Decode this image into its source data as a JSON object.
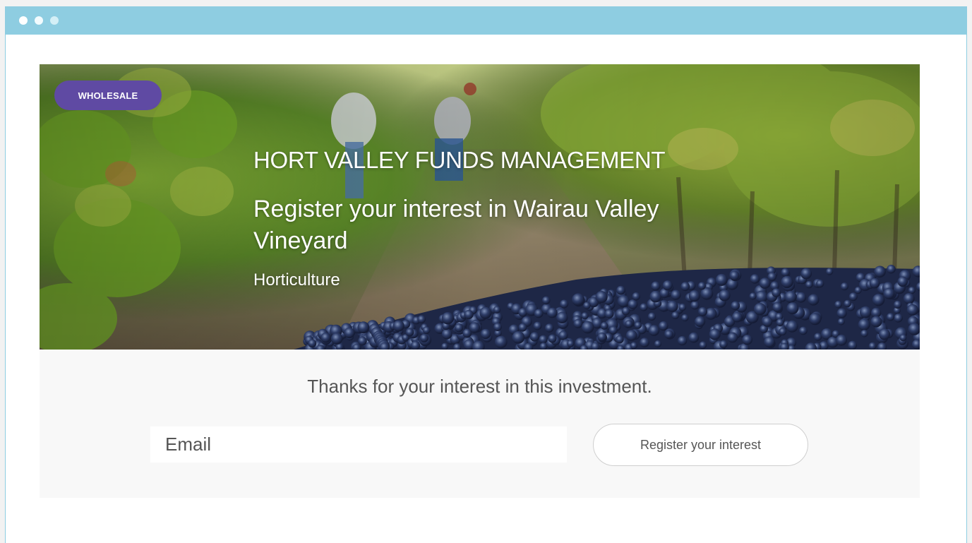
{
  "window": {
    "titlebar_color": "#8ecde1",
    "controls": [
      "close-dot",
      "minimize-dot",
      "maximize-dot"
    ]
  },
  "hero": {
    "badge": "WHOLESALE",
    "company": "HORT VALLEY FUNDS MANAGEMENT",
    "headline": "Register your interest in Wairau Valley Vineyard",
    "category": "Horticulture",
    "background": "vineyard-photo-with-workers-and-grapes",
    "badge_color": "#5f4aa3"
  },
  "form": {
    "message": "Thanks for your interest in this investment.",
    "email_placeholder": "Email",
    "email_value": "",
    "submit_label": "Register your interest"
  }
}
